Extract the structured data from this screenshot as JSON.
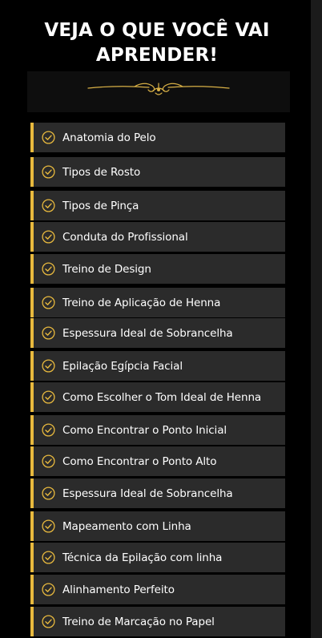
{
  "header": {
    "title": "VEJA  O QUE VOCÊ VAI\nAPRENDER!"
  },
  "ornament": {
    "icon": "gold-ornament-divider-icon",
    "color": "#d8b046"
  },
  "colors": {
    "background": "#000000",
    "item_background": "#2b2b2b",
    "accent_gold": "#e8b93e",
    "text": "#ffffff"
  },
  "topics": [
    {
      "label": "Anatomia do Pelo",
      "icon": "check-circle-icon"
    },
    {
      "label": "Tipos de Rosto",
      "icon": "check-circle-icon"
    },
    {
      "label": "Tipos de Pinça",
      "icon": "check-circle-icon"
    },
    {
      "label": "Conduta do Profissional",
      "icon": "check-circle-icon"
    },
    {
      "label": "Treino de Design",
      "icon": "check-circle-icon"
    },
    {
      "label": "Treino de Aplicação de Henna",
      "icon": "check-circle-icon"
    },
    {
      "label": "Espessura Ideal de Sobrancelha",
      "icon": "check-circle-icon"
    },
    {
      "label": "Epilação Egípcia Facial",
      "icon": "check-circle-icon"
    },
    {
      "label": "Como Escolher o Tom Ideal de Henna",
      "icon": "check-circle-icon"
    },
    {
      "label": "Como Encontrar o Ponto Inicial",
      "icon": "check-circle-icon"
    },
    {
      "label": "Como Encontrar o Ponto Alto",
      "icon": "check-circle-icon"
    },
    {
      "label": "Espessura Ideal de Sobrancelha",
      "icon": "check-circle-icon"
    },
    {
      "label": "Mapeamento com Linha",
      "icon": "check-circle-icon"
    },
    {
      "label": "Técnica da Epilação com linha",
      "icon": "check-circle-icon"
    },
    {
      "label": "Alinhamento Perfeito",
      "icon": "check-circle-icon"
    },
    {
      "label": "Treino de Marcação no Papel",
      "icon": "check-circle-icon"
    }
  ]
}
